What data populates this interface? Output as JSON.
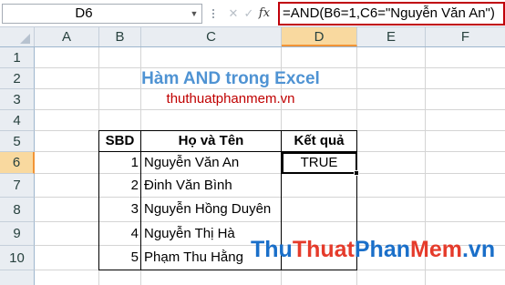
{
  "formula_bar": {
    "name_box": "D6",
    "fx_label": "fx",
    "formula": "=AND(B6=1,C6=\"Nguyễn Văn An\")"
  },
  "columns": [
    "A",
    "B",
    "C",
    "D",
    "E",
    "F"
  ],
  "rows": [
    "1",
    "2",
    "3",
    "4",
    "5",
    "6",
    "7",
    "8",
    "9",
    "10"
  ],
  "selected": {
    "column": "D",
    "row": "6"
  },
  "sheet": {
    "title": "Hàm AND trong Excel",
    "subtitle": "thuthuatphanmem.vn",
    "table": {
      "headers": {
        "sbd": "SBD",
        "name": "Họ và Tên",
        "result": "Kết quả"
      },
      "rows": [
        {
          "sbd": "1",
          "name": "Nguyễn Văn An",
          "result": "TRUE"
        },
        {
          "sbd": "2",
          "name": "Đinh Văn Bình",
          "result": ""
        },
        {
          "sbd": "3",
          "name": "Nguyễn Hồng Duyên",
          "result": ""
        },
        {
          "sbd": "4",
          "name": "Nguyễn Thị Hà",
          "result": ""
        },
        {
          "sbd": "5",
          "name": "Phạm Thu Hằng",
          "result": ""
        }
      ]
    }
  },
  "watermark": {
    "part1": "Thu",
    "part2": "Thuat",
    "part3": "Phan",
    "part4": "Mem",
    "part5": ".vn"
  },
  "colors": {
    "title": "#4f93d3",
    "subtitle": "#c00000",
    "formula_border": "#c0000a",
    "selection_header": "#f9d99f"
  }
}
